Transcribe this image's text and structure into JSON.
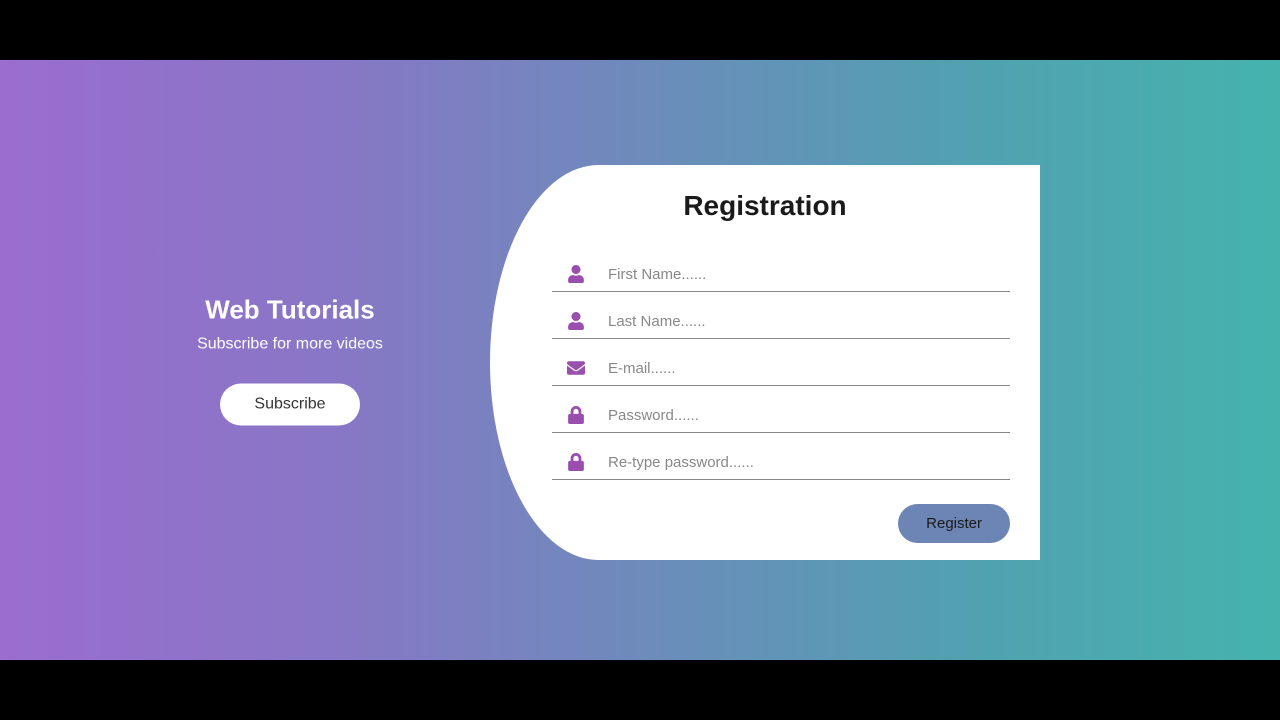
{
  "left": {
    "title": "Web Tutorials",
    "subtitle": "Subscribe for more videos",
    "button": "Subscribe"
  },
  "form": {
    "heading": "Registration",
    "fields": {
      "first_name_placeholder": "First Name......",
      "last_name_placeholder": "Last Name......",
      "email_placeholder": "E-mail......",
      "password_placeholder": "Password......",
      "retype_password_placeholder": "Re-type password......"
    },
    "submit": "Register"
  },
  "colors": {
    "icon": "#9a4eae",
    "register_bg": "#6c85b4",
    "gradient_start": "#9a6dcf",
    "gradient_end": "#45b3ad"
  }
}
